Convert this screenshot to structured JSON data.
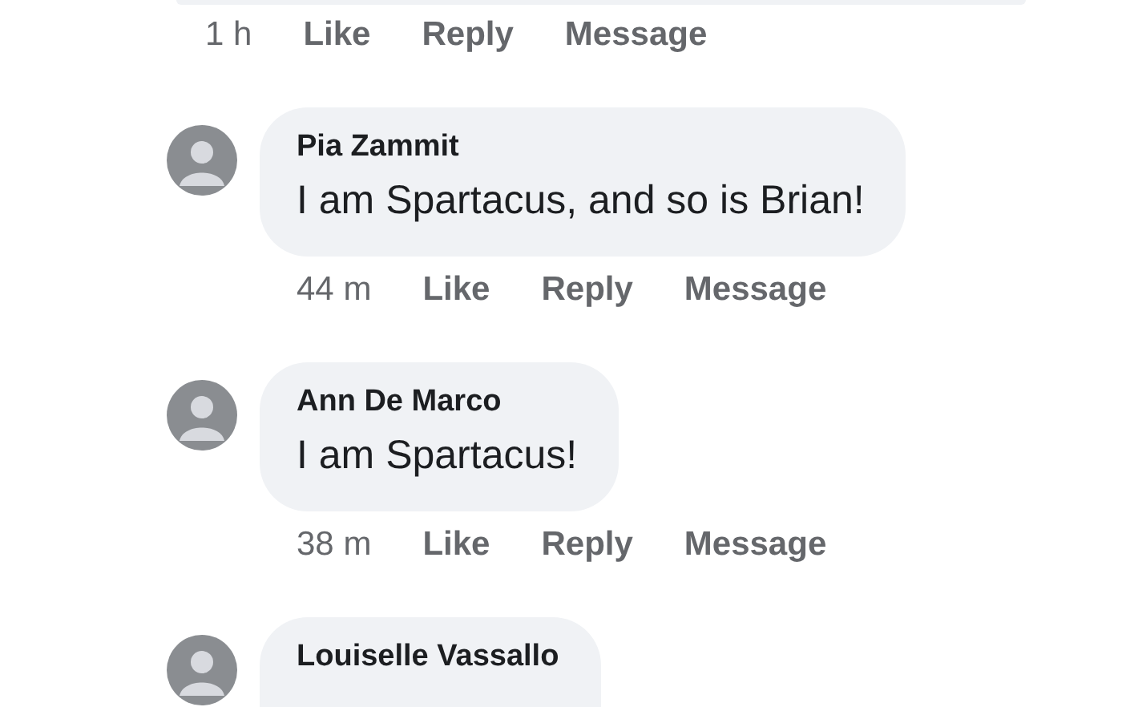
{
  "previous_comment": {
    "time": "1 h",
    "actions": [
      "Like",
      "Reply",
      "Message"
    ]
  },
  "comments": [
    {
      "author": "Pia Zammit",
      "text": "I am Spartacus, and so is Brian!",
      "time": "44 m",
      "actions": [
        "Like",
        "Reply",
        "Message"
      ]
    },
    {
      "author": "Ann De Marco",
      "text": "I am Spartacus!",
      "time": "38 m",
      "actions": [
        "Like",
        "Reply",
        "Message"
      ]
    },
    {
      "author": "Louiselle Vassallo"
    }
  ]
}
